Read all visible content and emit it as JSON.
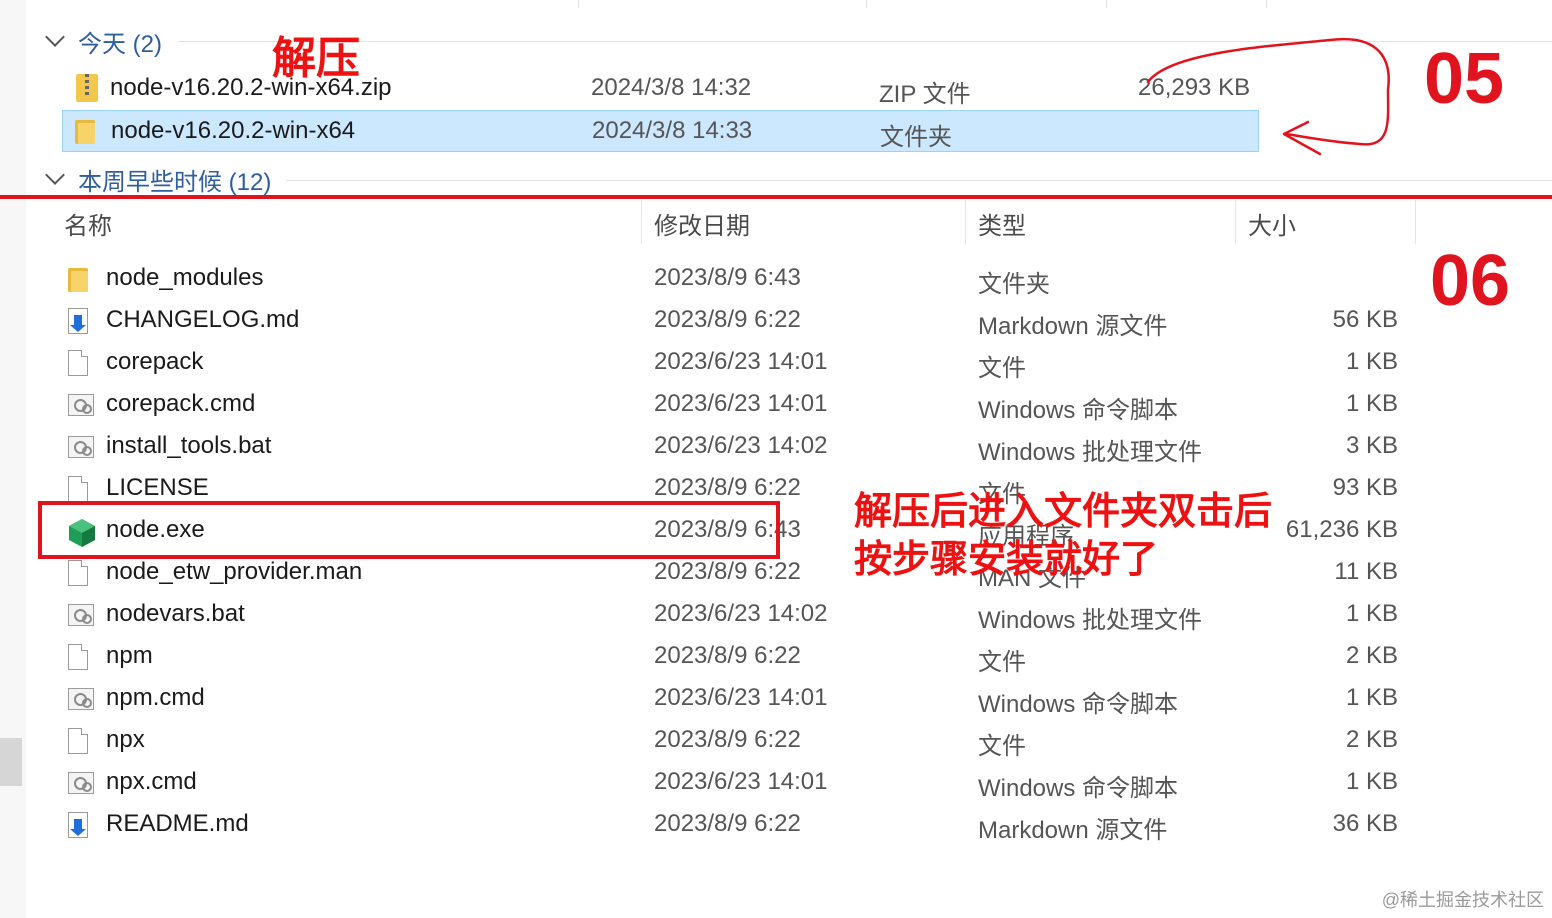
{
  "groups": {
    "today": {
      "label": "今天 (2)"
    },
    "earlier_this_week": {
      "label": "本周早些时候 (12)"
    }
  },
  "top_rows": [
    {
      "name": "node-v16.20.2-win-x64.zip",
      "date": "2024/3/8 14:32",
      "type": "ZIP 文件",
      "size": "26,293 KB",
      "icon": "zip-icon"
    },
    {
      "name": "node-v16.20.2-win-x64",
      "date": "2024/3/8 14:33",
      "type": "文件夹",
      "size": "",
      "icon": "folder-icon",
      "selected": true
    }
  ],
  "columns": {
    "name": "名称",
    "date": "修改日期",
    "type": "类型",
    "size": "大小"
  },
  "files": [
    {
      "name": "node_modules",
      "date": "2023/8/9 6:43",
      "type": "文件夹",
      "size": "",
      "icon": "folder-icon"
    },
    {
      "name": "CHANGELOG.md",
      "date": "2023/8/9 6:22",
      "type": "Markdown 源文件",
      "size": "56 KB",
      "icon": "markdown-icon"
    },
    {
      "name": "corepack",
      "date": "2023/6/23 14:01",
      "type": "文件",
      "size": "1 KB",
      "icon": "document-icon"
    },
    {
      "name": "corepack.cmd",
      "date": "2023/6/23 14:01",
      "type": "Windows 命令脚本",
      "size": "1 KB",
      "icon": "script-icon"
    },
    {
      "name": "install_tools.bat",
      "date": "2023/6/23 14:02",
      "type": "Windows 批处理文件",
      "size": "3 KB",
      "icon": "script-icon"
    },
    {
      "name": "LICENSE",
      "date": "2023/8/9 6:22",
      "type": "文件",
      "size": "93 KB",
      "icon": "document-icon"
    },
    {
      "name": "node.exe",
      "date": "2023/8/9 6:43",
      "type": "应用程序",
      "size": "61,236 KB",
      "icon": "nodejs-icon"
    },
    {
      "name": "node_etw_provider.man",
      "date": "2023/8/9 6:22",
      "type": "MAN 文件",
      "size": "11 KB",
      "icon": "document-icon"
    },
    {
      "name": "nodevars.bat",
      "date": "2023/6/23 14:02",
      "type": "Windows 批处理文件",
      "size": "1 KB",
      "icon": "script-icon"
    },
    {
      "name": "npm",
      "date": "2023/8/9 6:22",
      "type": "文件",
      "size": "2 KB",
      "icon": "document-icon"
    },
    {
      "name": "npm.cmd",
      "date": "2023/6/23 14:01",
      "type": "Windows 命令脚本",
      "size": "1 KB",
      "icon": "script-icon"
    },
    {
      "name": "npx",
      "date": "2023/8/9 6:22",
      "type": "文件",
      "size": "2 KB",
      "icon": "document-icon"
    },
    {
      "name": "npx.cmd",
      "date": "2023/6/23 14:01",
      "type": "Windows 命令脚本",
      "size": "1 KB",
      "icon": "script-icon"
    },
    {
      "name": "README.md",
      "date": "2023/8/9 6:22",
      "type": "Markdown 源文件",
      "size": "36 KB",
      "icon": "markdown-icon"
    }
  ],
  "annotations": {
    "extract_label": "解压",
    "step_05": "05",
    "step_06": "06",
    "note_line1": "解压后进入文件夹双击后",
    "note_line2": "按步骤安装就好了",
    "accent_color": "#e0141e"
  },
  "watermark": "@稀土掘金技术社区"
}
